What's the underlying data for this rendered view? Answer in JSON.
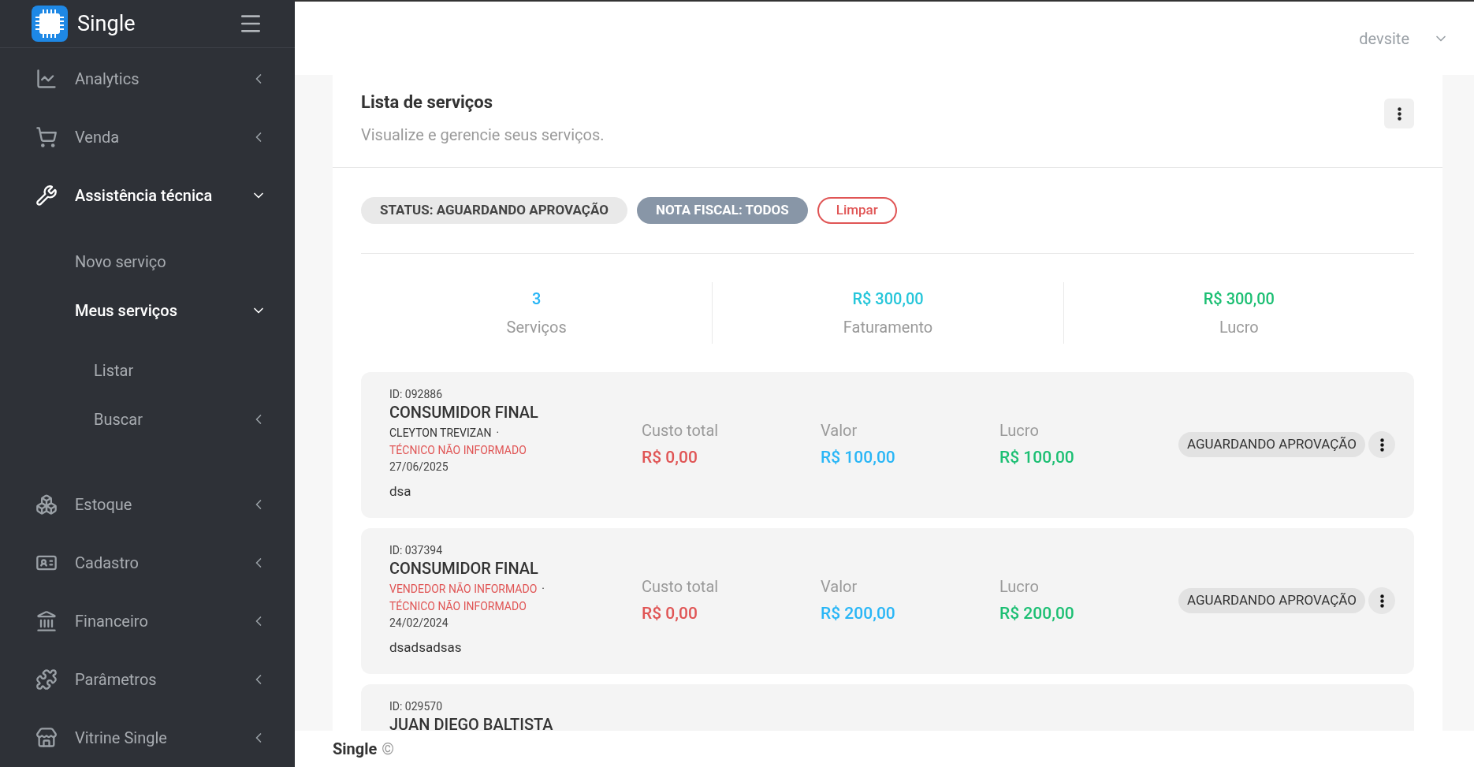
{
  "brand": {
    "name": "Single"
  },
  "user": {
    "name": "devsite"
  },
  "sidebar": {
    "items": [
      {
        "label": "Analytics",
        "expanded": false,
        "active": false
      },
      {
        "label": "Venda",
        "expanded": false,
        "active": false
      },
      {
        "label": "Assistência técnica",
        "expanded": true,
        "active": true,
        "children": [
          {
            "label": "Novo serviço",
            "active": false
          },
          {
            "label": "Meus serviços",
            "expanded": true,
            "active": true,
            "children": [
              {
                "label": "Listar",
                "active": false
              },
              {
                "label": "Buscar",
                "expanded": false,
                "active": false
              }
            ]
          }
        ]
      },
      {
        "label": "Estoque",
        "expanded": false,
        "active": false
      },
      {
        "label": "Cadastro",
        "expanded": false,
        "active": false
      },
      {
        "label": "Financeiro",
        "expanded": false,
        "active": false
      },
      {
        "label": "Parâmetros",
        "expanded": false,
        "active": false
      },
      {
        "label": "Vitrine Single",
        "expanded": false,
        "active": false
      }
    ]
  },
  "panel": {
    "title": "Lista de serviços",
    "subtitle": "Visualize e gerencie seus serviços.",
    "filters": [
      {
        "label": "STATUS: AGUARDANDO APROVAÇÃO",
        "kind": "light"
      },
      {
        "label": "NOTA FISCAL: TODOS",
        "kind": "dark"
      }
    ],
    "clear_button": "Limpar",
    "stats": [
      {
        "value": "3",
        "label": "Serviços",
        "color": "#29b6f6"
      },
      {
        "value": "R$ 300,00",
        "label": "Faturamento",
        "color": "#26c6da"
      },
      {
        "value": "R$ 300,00",
        "label": "Lucro",
        "color": "#1cbf73"
      }
    ],
    "services": [
      {
        "id": "ID: 092886",
        "customer": "CONSUMIDOR FINAL",
        "seller": {
          "text": "CLEYTON TREVIZAN",
          "missing": false
        },
        "separator": "·",
        "technician": {
          "text": "TÉCNICO NÃO INFORMADO",
          "missing": true
        },
        "date": "27/06/2025",
        "note": "dsa",
        "cost_label": "Custo total",
        "cost": "R$ 0,00",
        "value_label": "Valor",
        "value": "R$ 100,00",
        "profit_label": "Lucro",
        "profit": "R$ 100,00",
        "status": "AGUARDANDO APROVAÇÃO"
      },
      {
        "id": "ID: 037394",
        "customer": "CONSUMIDOR FINAL",
        "seller": {
          "text": "VENDEDOR NÃO INFORMADO",
          "missing": true
        },
        "separator": "·",
        "technician": {
          "text": "TÉCNICO NÃO INFORMADO",
          "missing": true
        },
        "date": "24/02/2024",
        "note": "dsadsadsas",
        "cost_label": "Custo total",
        "cost": "R$ 0,00",
        "value_label": "Valor",
        "value": "R$ 200,00",
        "profit_label": "Lucro",
        "profit": "R$ 200,00",
        "status": "AGUARDANDO APROVAÇÃO"
      },
      {
        "id": "ID: 029570",
        "customer": "JUAN DIEGO BALTISTA"
      }
    ]
  },
  "footer": {
    "brand": "Single",
    "mark": "©"
  }
}
